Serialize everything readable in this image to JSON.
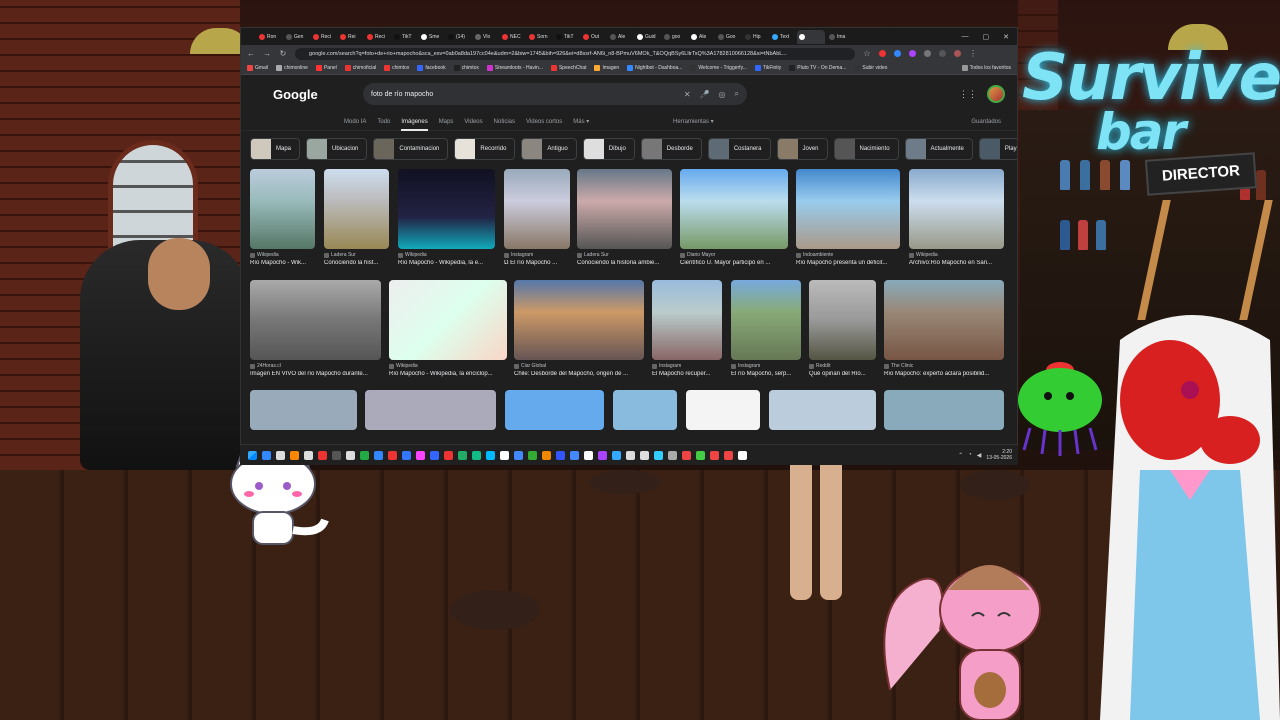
{
  "browser": {
    "tabs": [
      "Ron",
      "Gen",
      "Reci",
      "Rei",
      "Reci",
      "TikT",
      "Sme",
      "(14)",
      "Vlo",
      "NEC",
      "Sorn",
      "TikT",
      "Out",
      "Ale",
      "Guid",
      "goo",
      "Ale",
      "Goo",
      "Hip",
      "Text",
      "",
      "Ima"
    ],
    "url": "google.com/search?q=foto+de+rio+mapocho&sca_esv=0ab0a8da197cc04e&udm=2&biw=1745&bih=926&ei=d8ssrf-AN6i_n8-BPmuV6MOk_T&OQqBSy6LltrTsQ%3A1782810066128&si=tNbAbL...",
    "bookmarks": [
      "Gmail",
      "chimonline",
      "Panel",
      "chimoficial",
      "chimtox",
      "facebook",
      "chimtox",
      "Streamloots - Havin...",
      "SpeechChat",
      "Imagen",
      "Nightbot - Dashboa...",
      "Welcome - Triggerfy...",
      "TikFinity",
      "Pluto TV - On Dema...",
      "Subir video"
    ],
    "bookmarks_right": "Todos los favoritos"
  },
  "google": {
    "logo": "Google",
    "query": "foto de río mapocho",
    "tabs": [
      "Modo IA",
      "Todo",
      "Imágenes",
      "Maps",
      "Videos",
      "Noticias",
      "Videos cortos",
      "Más ▾"
    ],
    "tools": "Herramientas ▾",
    "saved": "Guardados",
    "chips": [
      "Mapa",
      "Ubicacion",
      "Contaminacion",
      "Recorrido",
      "Antiguo",
      "Dibujo",
      "Desborde",
      "Costanera",
      "Joven",
      "Nacimiento",
      "Actualmente",
      "Playa"
    ],
    "results_row1": [
      {
        "source": "Wikipedia",
        "title": "Río Mapocho - Wik..."
      },
      {
        "source": "Ladera Sur",
        "title": "Conociendo la hist..."
      },
      {
        "source": "Wikipedia",
        "title": "Río Mapocho - Wikipedia, la e..."
      },
      {
        "source": "Instagram",
        "title": "Ω El río Mapocho ..."
      },
      {
        "source": "Ladera Sur",
        "title": "Conociendo la historia ambie..."
      },
      {
        "source": "Diario Mayor",
        "title": "Científico U. Mayor participó en ..."
      },
      {
        "source": "Indoambiente",
        "title": "Río Mapocho presenta un déficit..."
      },
      {
        "source": "Wikipedia",
        "title": "Archivo:Río Mapocho en San..."
      }
    ],
    "results_row2": [
      {
        "source": "24Horas.cl",
        "title": "Imagen EN VIVO del río Mapocho durante..."
      },
      {
        "source": "Wikipedia",
        "title": "Río Mapocho - Wikipedia, la enciclop..."
      },
      {
        "source": "Ciar Global",
        "title": "Chile: Desborde del Mapocho, origen de ..."
      },
      {
        "source": "Instagram",
        "title": "El Mapocho recuper..."
      },
      {
        "source": "Instagram",
        "title": "El río Mapocho, serp..."
      },
      {
        "source": "Reddit",
        "title": "Qué opinan del Río..."
      },
      {
        "source": "The Clinic",
        "title": "Río Mapocho: experto aclara posibilid..."
      }
    ]
  },
  "taskbar": {
    "clock_time": "2:20",
    "clock_date": "13-05-2026"
  },
  "scene": {
    "neon_line1": "Survive",
    "neon_line2": "bar",
    "director_board": "DIRECTOR"
  }
}
